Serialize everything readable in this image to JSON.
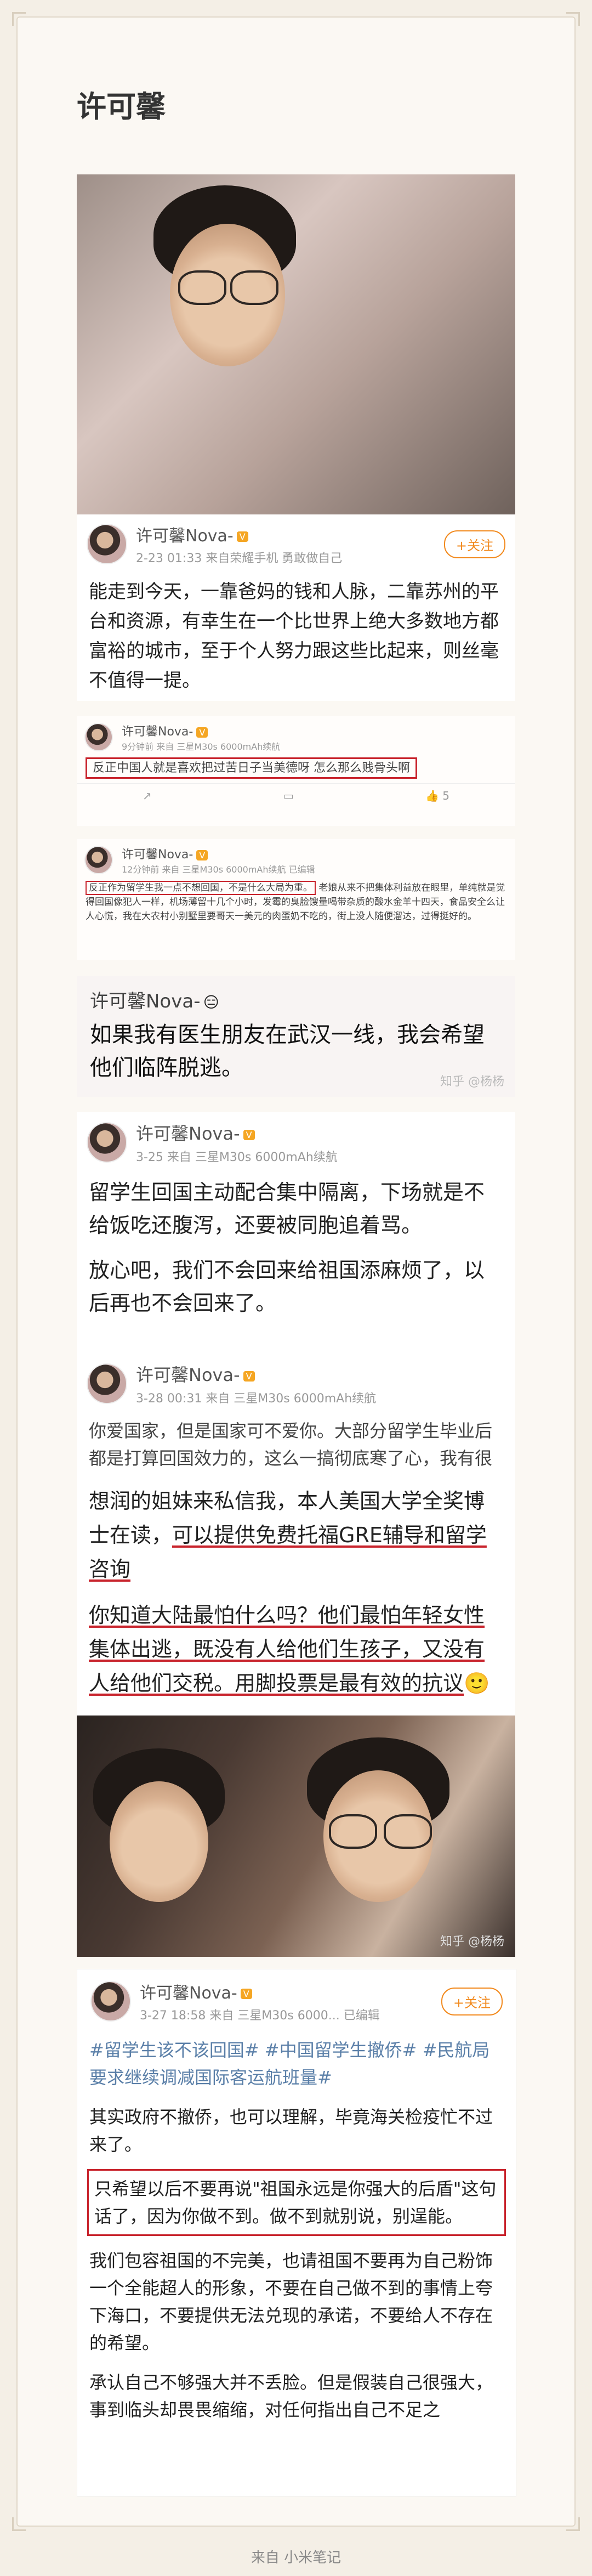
{
  "app": {
    "title": "许可馨",
    "footer": "来自 小米笔记"
  },
  "post1": {
    "username": "许可馨Nova-",
    "meta": "2-23 01:33 来自荣耀手机 勇敢做自己",
    "follow_label": "+关注",
    "text": "能走到今天，一靠爸妈的钱和人脉，二靠苏州的平台和资源，有幸生在一个比世界上绝大多数地方都富裕的城市，至于个人努力跟这些比起来，则丝毫不值得一提。"
  },
  "post2": {
    "username": "许可馨Nova-",
    "meta": "9分钟前 来自 三星M30s 6000mAh续航",
    "highlight": "反正中国人就是喜欢把过苦日子当美德呀 怎么那么贱骨头啊",
    "like_count": "5"
  },
  "post3": {
    "username": "许可馨Nova-",
    "meta": "12分钟前 来自 三星M30s 6000mAh续航 已编辑",
    "highlight": "反正作为留学生我一点不想回国，不是什么大局为重。",
    "rest": "老娘从来不把集体利益放在眼里，单纯就是觉得回国像犯人一样，机场薄留十几个小时，发霉的臭脸馊量喝带杂质的酸水金羊十四天，食品安全么让人心慌，我在大农村小别墅里要哥天一美元的肉蛋奶不吃的，街上没人随便溜达，过得挺好的。"
  },
  "post4": {
    "username": "许可馨Nova-",
    "text": "如果我有医生朋友在武汉一线，我会希望他们临阵脱逃。",
    "watermark": "知乎 @杨杨"
  },
  "post5": {
    "username": "许可馨Nova-",
    "meta": "3-25 来自 三星M30s 6000mAh续航",
    "para1": "留学生回国主动配合集中隔离，下场就是不给饭吃还腹泻，还要被同胞追着骂。",
    "para2": "放心吧，我们不会回来给祖国添麻烦了，以后再也不会回来了。"
  },
  "post6": {
    "username": "许可馨Nova-",
    "meta": "3-28 00:31 来自 三星M30s 6000mAh续航",
    "para1": "你爱国家，但是国家可不爱你。大部分留学生毕业后都是打算回国效力的，这么一搞彻底寒了心，我有很",
    "para2a": "想润的姐妹来私信我，本人美国大学全奖博士在读，",
    "para2b": "可以提供免费托福GRE辅导和留学咨询",
    "para3a": "你知道大陆最怕什么吗？他们最怕年轻女性集体出逃，",
    "para3b": "既没有人给他们生孩子，又没有人给他们交税。",
    "para3c": "用脚投票是最有效的抗议",
    "watermark": "知乎 @杨杨"
  },
  "post7": {
    "username": "许可馨Nova-",
    "meta": "3-27 18:58 来自 三星M30s 6000... 已编辑",
    "follow_label": "+关注",
    "tags": "#留学生该不该回国# #中国留学生撤侨# #民航局要求继续调减国际客运航班量#",
    "para1": "其实政府不撤侨，也可以理解，毕竟海关检疫忙不过来了。",
    "para2": "只希望以后不要再说\"祖国永远是你强大的后盾\"这句话了，因为你做不到。做不到就别说，别逞能。",
    "para3": "我们包容祖国的不完美，也请祖国不要再为自己粉饰一个全能超人的形象，不要在自己做不到的事情上夸下海口，不要提供无法兑现的承诺，不要给人不存在的希望。",
    "para4": "承认自己不够强大并不丢脸。但是假装自己很强大，事到临头却畏畏缩缩，对任何指出自己不足之"
  }
}
